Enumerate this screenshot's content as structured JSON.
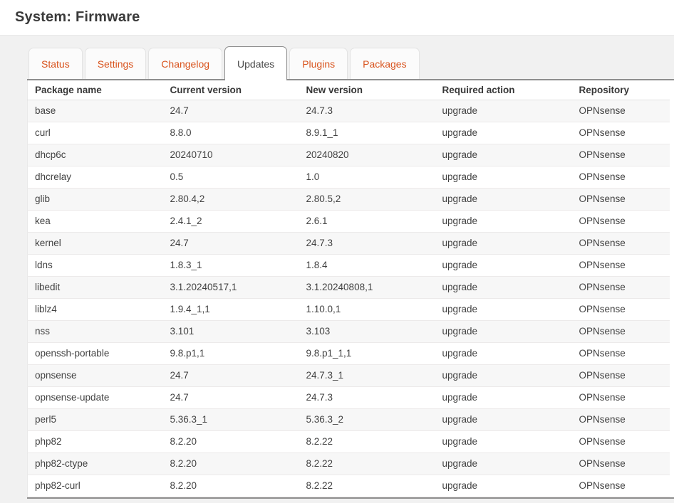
{
  "page": {
    "title": "System: Firmware"
  },
  "tabs": [
    {
      "label": "Status",
      "active": false
    },
    {
      "label": "Settings",
      "active": false
    },
    {
      "label": "Changelog",
      "active": false
    },
    {
      "label": "Updates",
      "active": true
    },
    {
      "label": "Plugins",
      "active": false
    },
    {
      "label": "Packages",
      "active": false
    }
  ],
  "table": {
    "columns": [
      "Package name",
      "Current version",
      "New version",
      "Required action",
      "Repository"
    ],
    "rows": [
      [
        "base",
        "24.7",
        "24.7.3",
        "upgrade",
        "OPNsense"
      ],
      [
        "curl",
        "8.8.0",
        "8.9.1_1",
        "upgrade",
        "OPNsense"
      ],
      [
        "dhcp6c",
        "20240710",
        "20240820",
        "upgrade",
        "OPNsense"
      ],
      [
        "dhcrelay",
        "0.5",
        "1.0",
        "upgrade",
        "OPNsense"
      ],
      [
        "glib",
        "2.80.4,2",
        "2.80.5,2",
        "upgrade",
        "OPNsense"
      ],
      [
        "kea",
        "2.4.1_2",
        "2.6.1",
        "upgrade",
        "OPNsense"
      ],
      [
        "kernel",
        "24.7",
        "24.7.3",
        "upgrade",
        "OPNsense"
      ],
      [
        "ldns",
        "1.8.3_1",
        "1.8.4",
        "upgrade",
        "OPNsense"
      ],
      [
        "libedit",
        "3.1.20240517,1",
        "3.1.20240808,1",
        "upgrade",
        "OPNsense"
      ],
      [
        "liblz4",
        "1.9.4_1,1",
        "1.10.0,1",
        "upgrade",
        "OPNsense"
      ],
      [
        "nss",
        "3.101",
        "3.103",
        "upgrade",
        "OPNsense"
      ],
      [
        "openssh-portable",
        "9.8.p1,1",
        "9.8.p1_1,1",
        "upgrade",
        "OPNsense"
      ],
      [
        "opnsense",
        "24.7",
        "24.7.3_1",
        "upgrade",
        "OPNsense"
      ],
      [
        "opnsense-update",
        "24.7",
        "24.7.3",
        "upgrade",
        "OPNsense"
      ],
      [
        "perl5",
        "5.36.3_1",
        "5.36.3_2",
        "upgrade",
        "OPNsense"
      ],
      [
        "php82",
        "8.2.20",
        "8.2.22",
        "upgrade",
        "OPNsense"
      ],
      [
        "php82-ctype",
        "8.2.20",
        "8.2.22",
        "upgrade",
        "OPNsense"
      ],
      [
        "php82-curl",
        "8.2.20",
        "8.2.22",
        "upgrade",
        "OPNsense"
      ]
    ]
  },
  "colors": {
    "accent_orange": "#d9541e",
    "active_tab_text": "#4a4a4a",
    "dark_border": "#8e8e8e",
    "page_background": "#f1f1f1",
    "row_stripe": "#f7f7f7"
  }
}
